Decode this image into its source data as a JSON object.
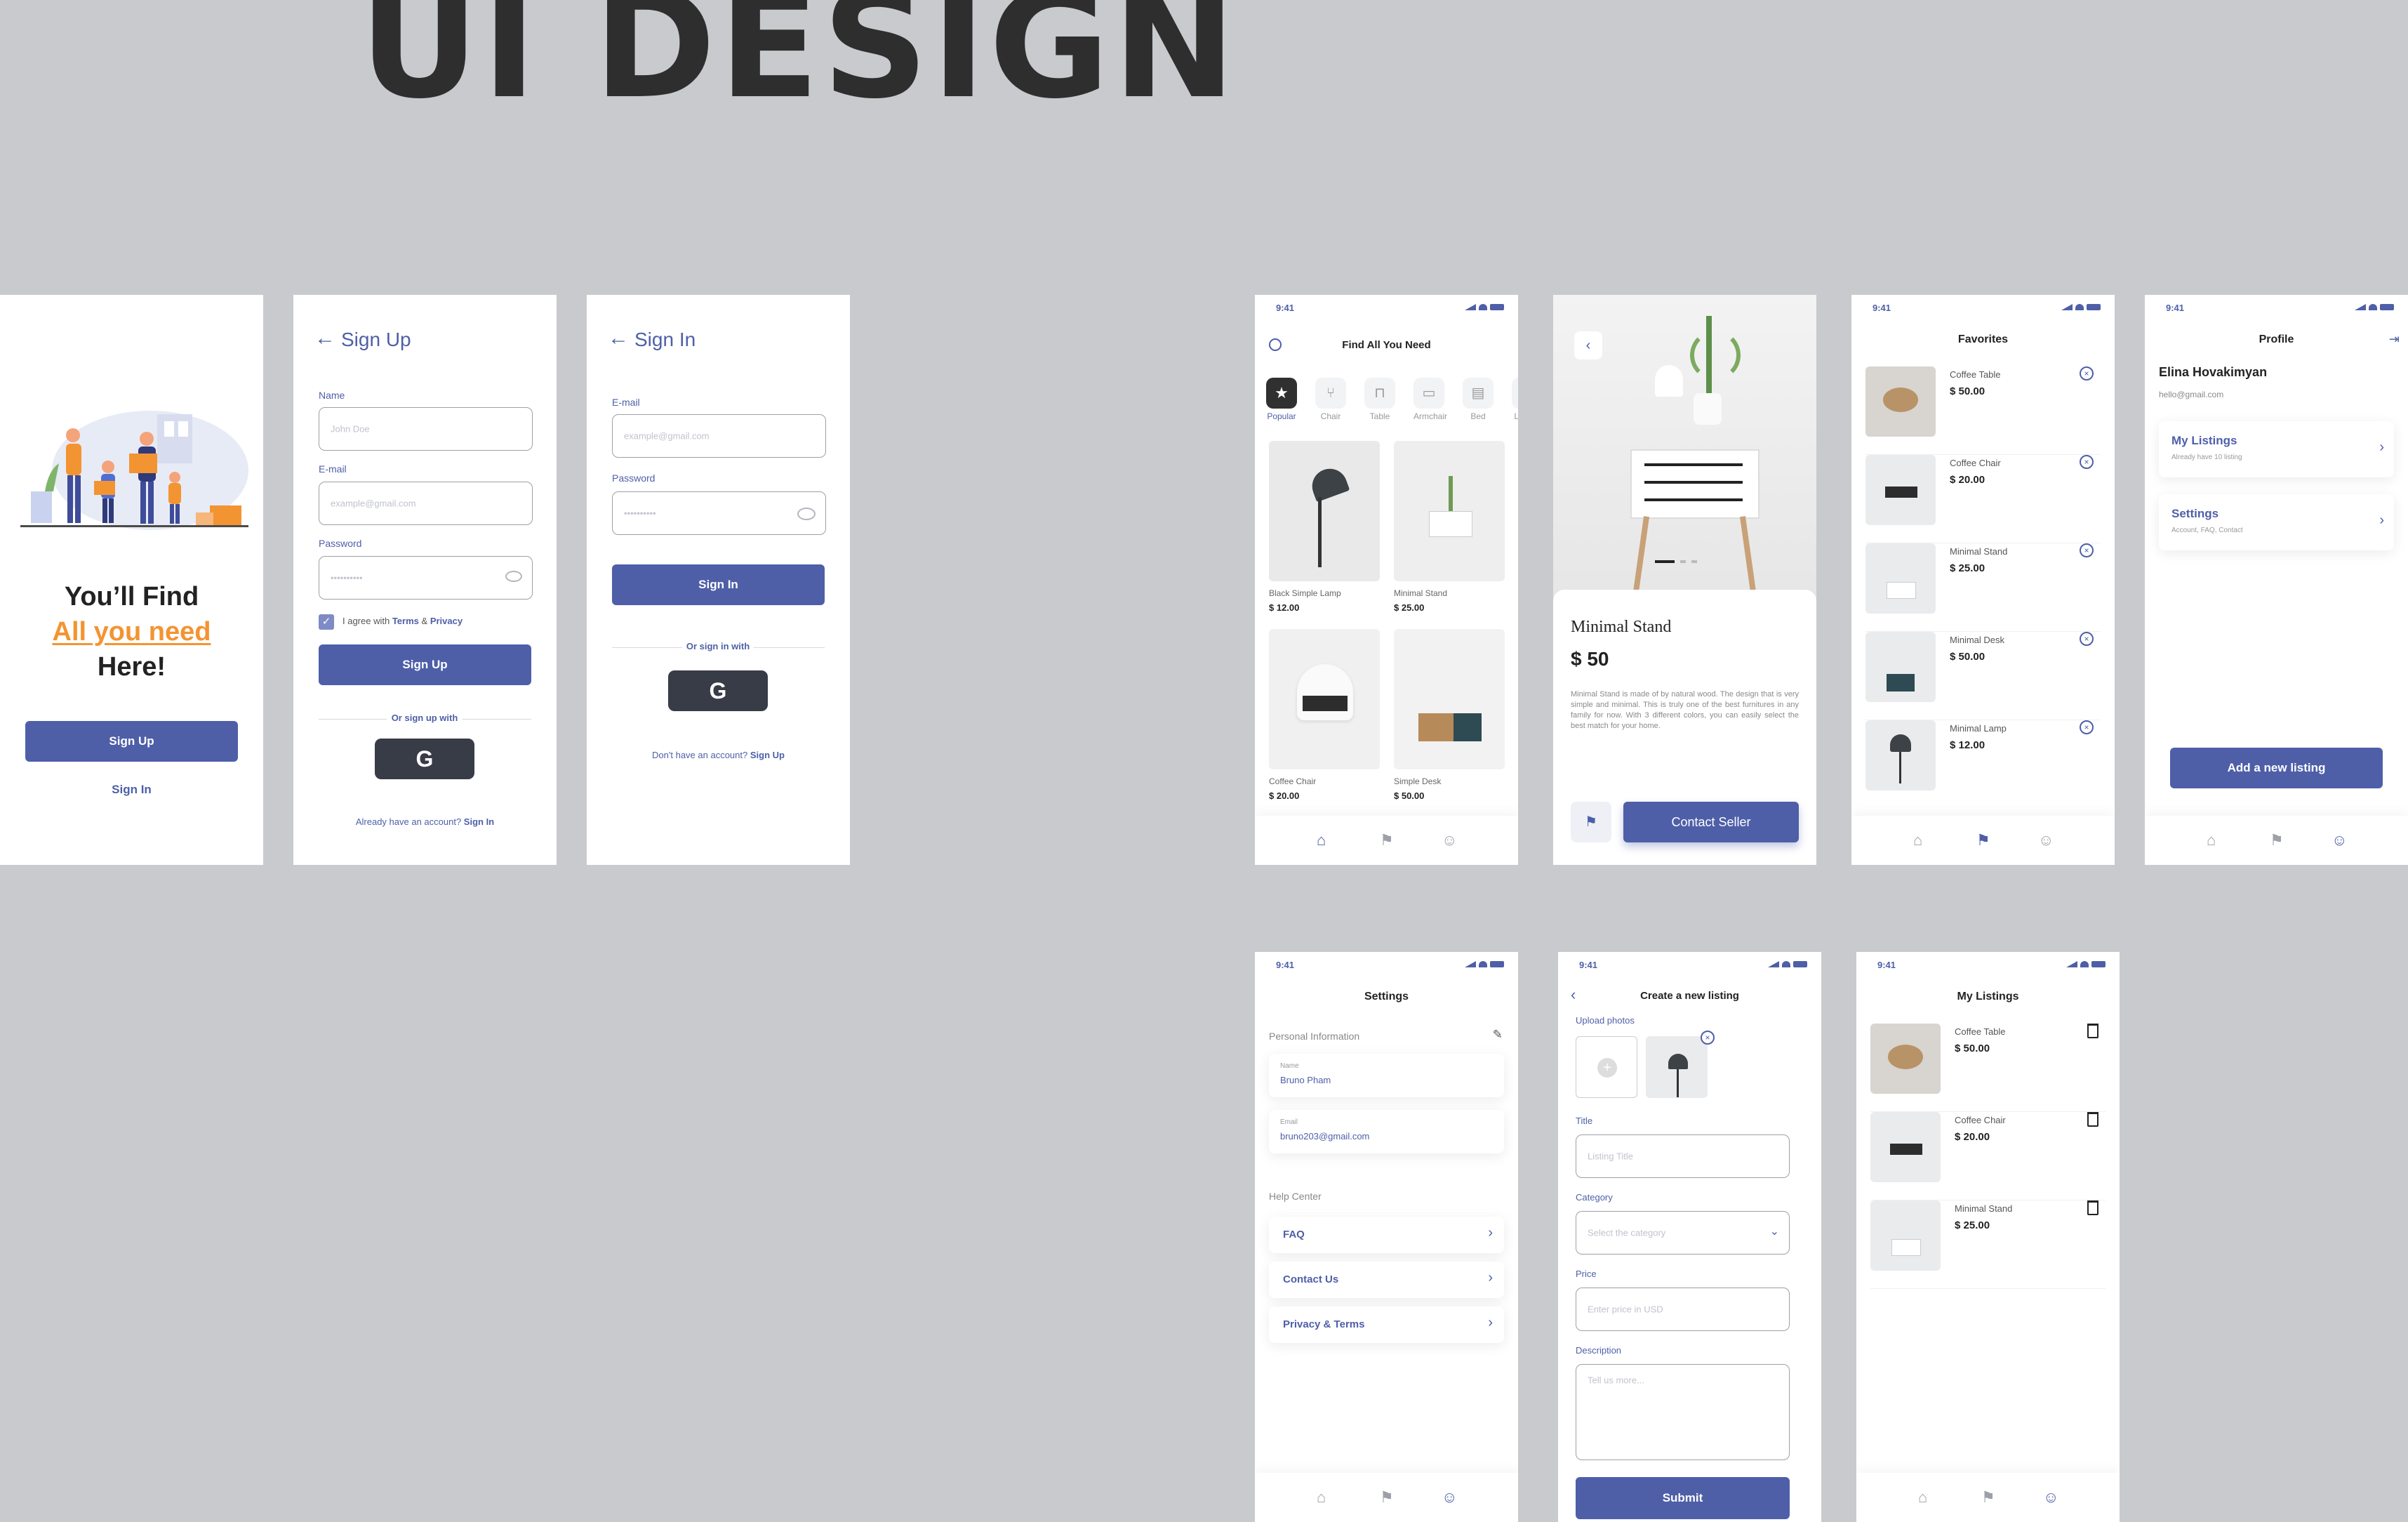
{
  "headline": "UI DESIGN",
  "status_time": "9:41",
  "onboarding": {
    "line1": "You’ll Find",
    "line2": "All you need",
    "line3": "Here!",
    "signup_label": "Sign Up",
    "signin_label": "Sign In"
  },
  "signup": {
    "title": "Sign Up",
    "name_label": "Name",
    "name_placeholder": "John Doe",
    "email_label": "E-mail",
    "email_placeholder": "example@gmail.com",
    "password_label": "Password",
    "password_value": "••••••••••",
    "agree_prefix": "I agree with",
    "terms": "Terms",
    "amp": "&",
    "privacy": "Privacy",
    "button": "Sign Up",
    "or_text": "Or sign up with",
    "google": "G",
    "footer_text": "Already have an account?",
    "footer_link": "Sign In"
  },
  "signin": {
    "title": "Sign In",
    "email_label": "E-mail",
    "email_placeholder": "example@gmail.com",
    "password_label": "Password",
    "password_value": "••••••••••",
    "button": "Sign In",
    "or_text": "Or sign in with",
    "google": "G",
    "footer_text": "Don't have an account?",
    "footer_link": "Sign Up"
  },
  "home": {
    "title": "Find All You Need",
    "categories": [
      "Popular",
      "Chair",
      "Table",
      "Armchair",
      "Bed",
      "La"
    ],
    "products": [
      {
        "name": "Black Simple Lamp",
        "price": "$ 12.00"
      },
      {
        "name": "Minimal Stand",
        "price": "$ 25.00"
      },
      {
        "name": "Coffee Chair",
        "price": "$ 20.00"
      },
      {
        "name": "Simple Desk",
        "price": "$ 50.00"
      }
    ]
  },
  "detail": {
    "name": "Minimal Stand",
    "price": "$ 50",
    "description": "Minimal Stand is made of by natural wood. The design that is very simple and minimal. This is truly one of the best furnitures in any family for now. With 3 different colors, you can easily select the best match for your home.",
    "contact": "Contact Seller"
  },
  "favorites": {
    "title": "Favorites",
    "items": [
      {
        "name": "Coffee Table",
        "price": "$ 50.00"
      },
      {
        "name": "Coffee Chair",
        "price": "$ 20.00"
      },
      {
        "name": "Minimal Stand",
        "price": "$ 25.00"
      },
      {
        "name": "Minimal Desk",
        "price": "$ 50.00"
      },
      {
        "name": "Minimal Lamp",
        "price": "$ 12.00"
      }
    ]
  },
  "profile": {
    "title": "Profile",
    "user_name": "Elina Hovakimyan",
    "user_email": "hello@gmail.com",
    "listings_title": "My Listings",
    "listings_sub": "Already have 10 listing",
    "settings_title": "Settings",
    "settings_sub": "Account, FAQ, Contact",
    "add_button": "Add a new listing"
  },
  "settings": {
    "title": "Settings",
    "section_personal": "Personal Information",
    "name_label": "Name",
    "name_value": "Bruno Pham",
    "email_label": "Email",
    "email_value": "bruno203@gmail.com",
    "section_help": "Help Center",
    "items": [
      "FAQ",
      "Contact Us",
      "Privacy & Terms"
    ]
  },
  "newlisting": {
    "title": "Create a new listing",
    "upload_label": "Upload photos",
    "title_label": "Title",
    "title_placeholder": "Listing Title",
    "category_label": "Category",
    "category_placeholder": "Select the category",
    "price_label": "Price",
    "price_placeholder": "Enter price in USD",
    "desc_label": "Description",
    "desc_placeholder": "Tell us more...",
    "submit": "Submit"
  },
  "mylistings": {
    "title": "My Listings",
    "items": [
      {
        "name": "Coffee Table",
        "price": "$ 50.00"
      },
      {
        "name": "Coffee Chair",
        "price": "$ 20.00"
      },
      {
        "name": "Minimal Stand",
        "price": "$ 25.00"
      }
    ]
  },
  "colors": {
    "accent": "#4e5fa8",
    "highlight": "#f39432",
    "dark_button": "#383c47",
    "background": "#c9cacd"
  }
}
